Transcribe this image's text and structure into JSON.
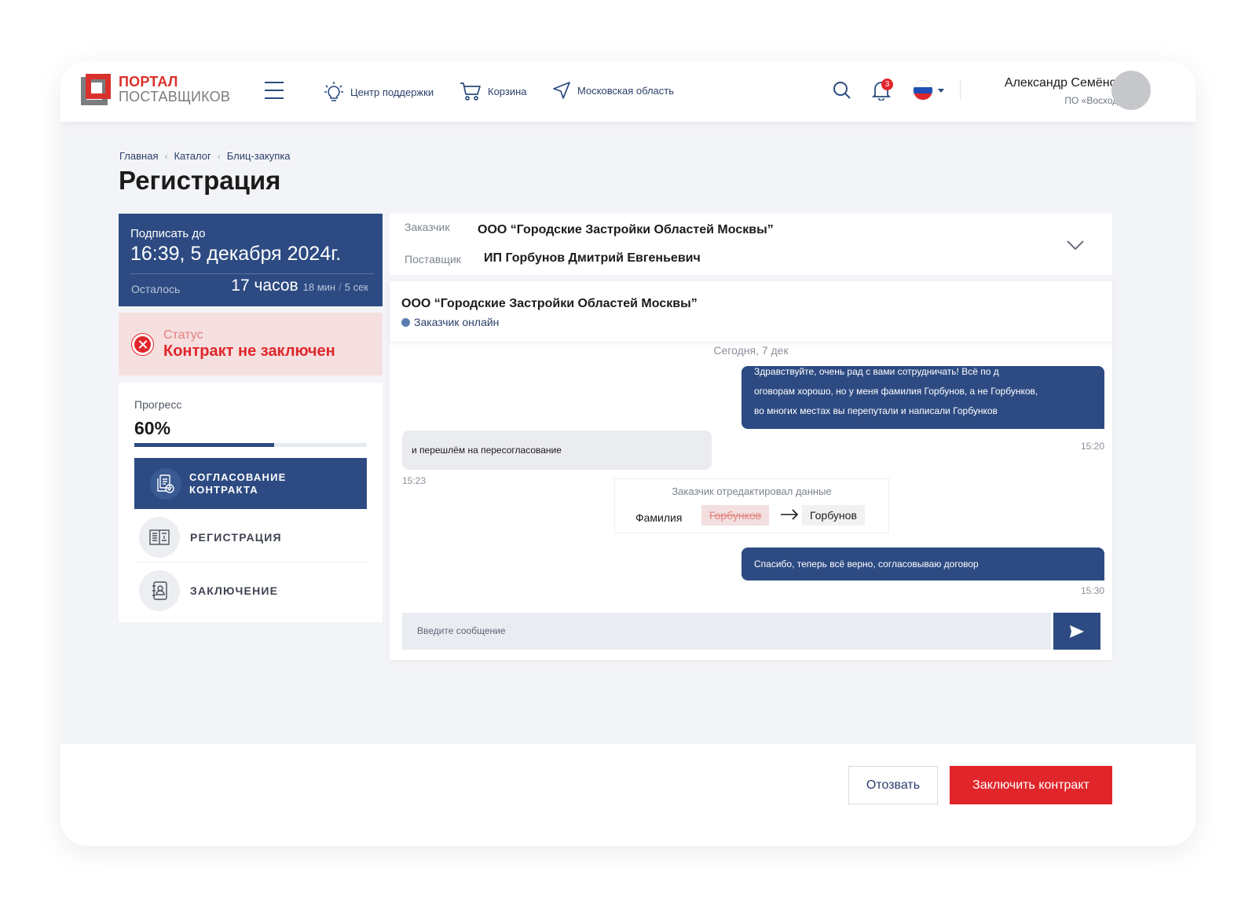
{
  "header": {
    "logo": {
      "line1": "ПОРТАЛ",
      "line2": "ПОСТАВЩИКОВ"
    },
    "nav": [
      {
        "label": "Центр поддержки",
        "icon": "lightbulb-icon"
      },
      {
        "label": "Корзина",
        "icon": "cart-icon"
      },
      {
        "label": "Московская область",
        "icon": "location-arrow-icon"
      }
    ],
    "notifications_count": "3",
    "language": "RU",
    "user": {
      "name": "Александр Семёнов",
      "org": "ПО «Восход»"
    }
  },
  "breadcrumbs": [
    "Главная",
    "Каталог",
    "Блиц-закупка"
  ],
  "page_title": "Регистрация",
  "deadline": {
    "label": "Подписать до",
    "date": "16:39, 5 декабря 2024г.",
    "remaining_label": "Осталось",
    "hours": "17 часов",
    "minutes": "18 мин",
    "seconds": "5 сек"
  },
  "status": {
    "label": "Статус",
    "value": "Контракт не заключен"
  },
  "progress": {
    "label": "Прогресс",
    "value": "60%",
    "percent": 60,
    "steps": [
      {
        "label_line1": "СОГЛАСОВАНИЕ",
        "label_line2": "КОНТРАКТА",
        "state": "active",
        "icon": "document-check-icon"
      },
      {
        "label": "РЕГИСТРАЦИЯ",
        "state": "inactive",
        "icon": "registry-book-icon"
      },
      {
        "label": "ЗАКЛЮЧЕНИЕ",
        "state": "inactive",
        "icon": "contact-book-icon"
      }
    ]
  },
  "parties": {
    "customer_label": "Заказчик",
    "customer": "ООО “Городские Застройки Областей Москвы”",
    "supplier_label": "Поставщик",
    "supplier": "ИП Горбунов Дмитрий Евгеньевич"
  },
  "chat": {
    "title": "ООО “Городские Застройки Областей Москвы”",
    "online_status": "Заказчик онлайн",
    "date_divider": "Сегодня, 7 дек",
    "messages": [
      {
        "direction": "out",
        "lines": [
          "Здравствуйте, очень рад с вами сотрудничать! Всё по д",
          "оговорам хорошо, но у меня фамилия Горбунов, а не Горбунков,",
          "во многих местах вы перепутали и написали Горбунков"
        ],
        "time": "15:20"
      },
      {
        "direction": "in",
        "text": "и перешлём на пересогласование",
        "time": "15:23"
      },
      {
        "direction": "out",
        "text": "Спасибо, теперь всё верно, согласовываю договор",
        "time": "15:30"
      }
    ],
    "edit_event": {
      "title": "Заказчик отредактировал данные",
      "field": "Фамилия",
      "old_value": "Горбунков",
      "new_value": "Горбунов"
    },
    "input_placeholder": "Введите сообщение"
  },
  "footer": {
    "withdraw_label": "Отозвать",
    "sign_label": "Заключить контракт"
  },
  "colors": {
    "primary": "#2d4b82",
    "danger": "#e0262b",
    "status_bg": "#f5dfdf",
    "page_bg": "#f3f4f7"
  }
}
